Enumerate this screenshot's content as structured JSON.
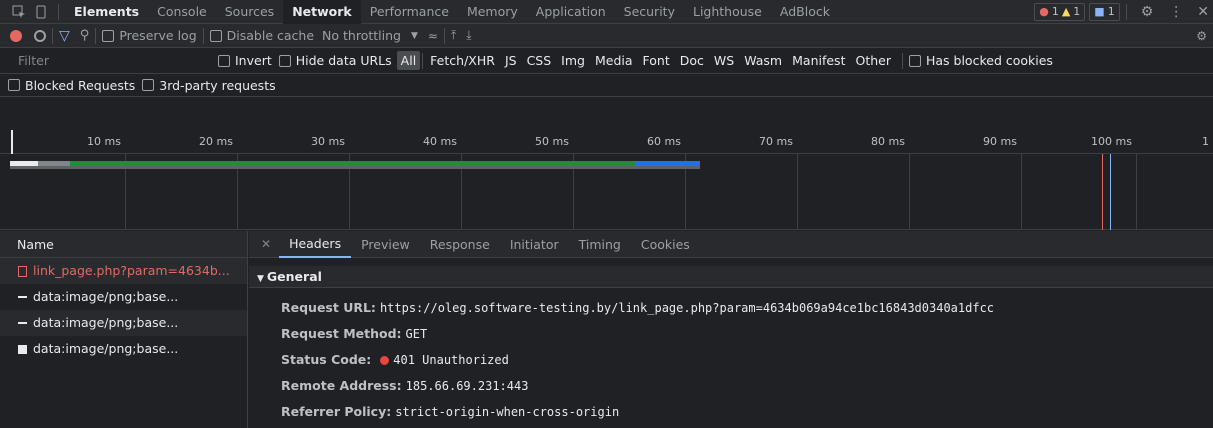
{
  "tabs": [
    "Elements",
    "Console",
    "Sources",
    "Network",
    "Performance",
    "Memory",
    "Application",
    "Security",
    "Lighthouse",
    "AdBlock"
  ],
  "active_tab": "Network",
  "badges": {
    "errors": "1",
    "warnings": "1",
    "messages": "1"
  },
  "toolbar": {
    "preserve_log": "Preserve log",
    "disable_cache": "Disable cache",
    "throttling": "No throttling"
  },
  "filter": {
    "placeholder": "Filter",
    "invert": "Invert",
    "hide_data_urls": "Hide data URLs",
    "types": [
      "All",
      "Fetch/XHR",
      "JS",
      "CSS",
      "Img",
      "Media",
      "Font",
      "Doc",
      "WS",
      "Wasm",
      "Manifest",
      "Other"
    ],
    "active_type": "All",
    "has_blocked_cookies": "Has blocked cookies",
    "blocked_requests": "Blocked Requests",
    "third_party": "3rd-party requests"
  },
  "timeline": {
    "ticks": [
      "10 ms",
      "20 ms",
      "30 ms",
      "40 ms",
      "50 ms",
      "60 ms",
      "70 ms",
      "80 ms",
      "90 ms",
      "100 ms",
      "1"
    ]
  },
  "name_header": "Name",
  "requests": [
    {
      "name": "link_page.php?param=4634b..."
    },
    {
      "name": "data:image/png;base..."
    },
    {
      "name": "data:image/png;base..."
    },
    {
      "name": "data:image/png;base..."
    }
  ],
  "detail_tabs": [
    "Headers",
    "Preview",
    "Response",
    "Initiator",
    "Timing",
    "Cookies"
  ],
  "active_detail_tab": "Headers",
  "general": {
    "title": "General",
    "request_url_label": "Request URL:",
    "request_url": "https://oleg.software-testing.by/link_page.php?param=4634b069a94ce1bc16843d0340a1dfcc",
    "method_label": "Request Method:",
    "method": "GET",
    "status_label": "Status Code:",
    "status": "401 Unauthorized",
    "remote_label": "Remote Address:",
    "remote": "185.66.69.231:443",
    "referrer_label": "Referrer Policy:",
    "referrer": "strict-origin-when-cross-origin"
  },
  "colors": {
    "bg": "#202124",
    "error": "#e46962",
    "accent": "#8ab4f8",
    "bar_green": "#1e8e3e",
    "bar_blue": "#1a73e8"
  }
}
